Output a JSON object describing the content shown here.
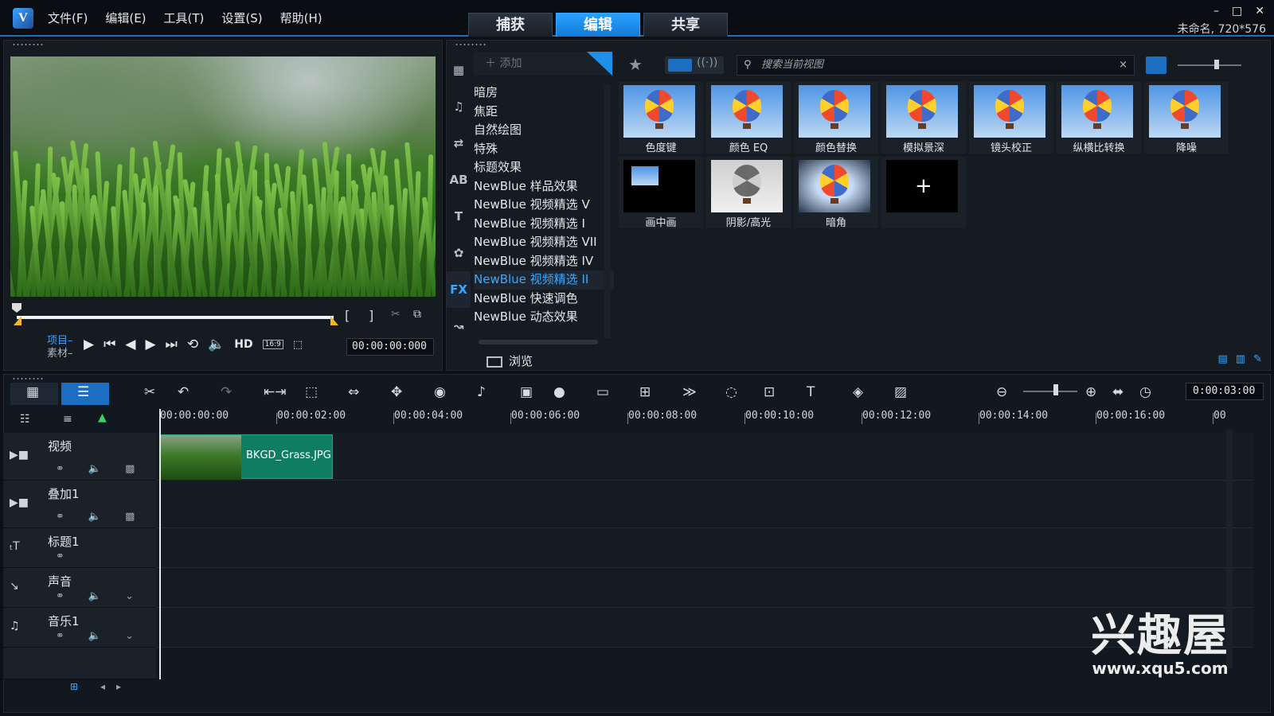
{
  "menu": [
    "文件(F)",
    "编辑(E)",
    "工具(T)",
    "设置(S)",
    "帮助(H)"
  ],
  "mode_tabs": [
    {
      "label": "捕获",
      "active": false
    },
    {
      "label": "编辑",
      "active": true
    },
    {
      "label": "共享",
      "active": false
    }
  ],
  "project_info": "未命名, 720*576",
  "window_controls": [
    "–",
    "□",
    "✕"
  ],
  "preview": {
    "mode_project": "项目–",
    "mode_clip": "素材–",
    "hd_label": "HD",
    "ratio_label": "16:9",
    "timecode": "00:00:00:000",
    "bracket_in": "[",
    "bracket_out": "]"
  },
  "library": {
    "add_label": "添加",
    "categories": [
      "暗房",
      "焦距",
      "自然绘图",
      "特殊",
      "标题效果",
      "NewBlue 样品效果",
      "NewBlue 视频精选 V",
      "NewBlue 视频精选 I",
      "NewBlue 视频精选 VII",
      "NewBlue 视频精选 IV",
      "NewBlue 视频精选 II",
      "NewBlue 快速调色",
      "NewBlue 动态效果"
    ],
    "selected_category": "NewBlue 视频精选 II",
    "browse_label": "浏览",
    "search_placeholder": "搜索当前视图",
    "side_icons": [
      "media-icon",
      "music-icon",
      "transition-icon",
      "title-ab-icon",
      "text-icon",
      "graphics-icon",
      "fx-icon",
      "path-icon"
    ],
    "fx_label": "FX",
    "effects": [
      {
        "label": "色度键",
        "style": "sky"
      },
      {
        "label": "颜色 EQ",
        "style": "sky"
      },
      {
        "label": "颜色替换",
        "style": "sky"
      },
      {
        "label": "模拟景深",
        "style": "sky"
      },
      {
        "label": "镜头校正",
        "style": "sky"
      },
      {
        "label": "纵横比转换",
        "style": "sky"
      },
      {
        "label": "降噪",
        "style": "sky"
      },
      {
        "label": "画中画",
        "style": "dark"
      },
      {
        "label": "阴影/高光",
        "style": "grey"
      },
      {
        "label": "暗角",
        "style": "vign"
      },
      {
        "label": "",
        "style": "add"
      }
    ]
  },
  "timeline": {
    "timecode": "0:00:03:00",
    "ruler": [
      "00:00:00:00",
      "00:00:02:00",
      "00:00:04:00",
      "00:00:06:00",
      "00:00:08:00",
      "00:00:10:00",
      "00:00:12:00",
      "00:00:14:00",
      "00:00:16:00",
      "00"
    ],
    "tracks": [
      {
        "name": "视频",
        "icon": "video-track-icon"
      },
      {
        "name": "叠加1",
        "icon": "overlay-track-icon"
      },
      {
        "name": "标题1",
        "icon": "title-track-icon"
      },
      {
        "name": "声音",
        "icon": "voice-track-icon"
      },
      {
        "name": "音乐1",
        "icon": "music-track-icon"
      }
    ],
    "clip_name": "BKGD_Grass.JPG"
  },
  "watermark": {
    "big": "兴趣屋",
    "small": "www.xqu5.com"
  }
}
